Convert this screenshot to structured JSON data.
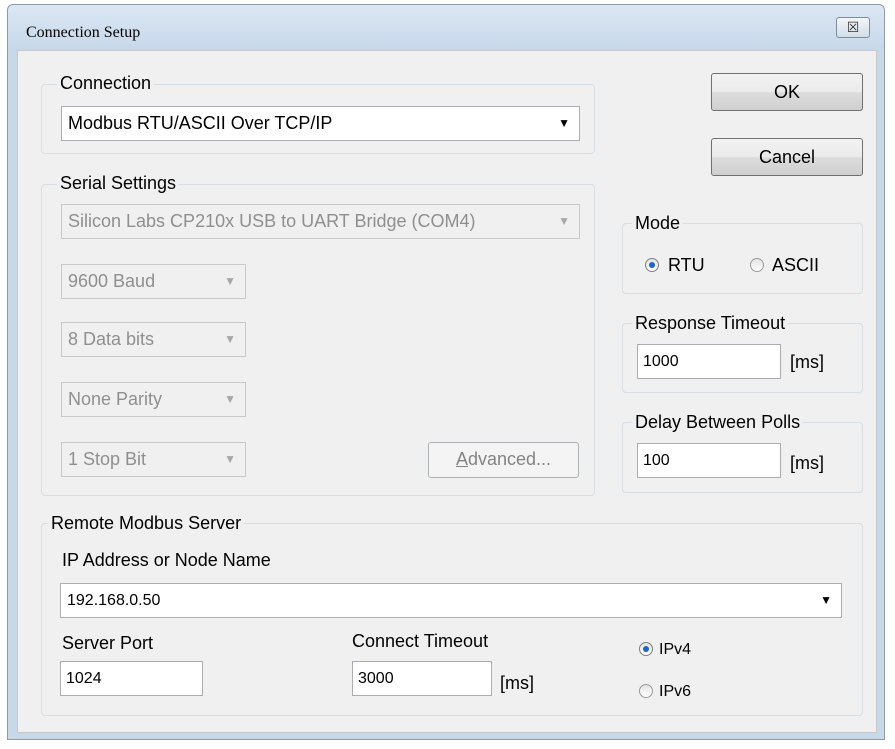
{
  "window": {
    "title": "Connection Setup",
    "close_glyph": "☒"
  },
  "connection": {
    "legend": "Connection",
    "selected": "Modbus RTU/ASCII Over TCP/IP"
  },
  "serial": {
    "legend": "Serial Settings",
    "port": "Silicon Labs CP210x USB to UART Bridge (COM4)",
    "baud": "9600 Baud",
    "data_bits": "8 Data bits",
    "parity": "None Parity",
    "stop_bits": "1 Stop Bit",
    "advanced_label": "Advanced...",
    "advanced_mnemonic": "A",
    "advanced_rest": "dvanced..."
  },
  "buttons": {
    "ok": "OK",
    "cancel": "Cancel"
  },
  "mode": {
    "legend": "Mode",
    "options": [
      "RTU",
      "ASCII"
    ],
    "selected": "RTU"
  },
  "response_timeout": {
    "legend": "Response Timeout",
    "value": "1000",
    "unit": "[ms]"
  },
  "delay_between_polls": {
    "legend": "Delay Between Polls",
    "value": "100",
    "unit": "[ms]"
  },
  "remote": {
    "legend": "Remote Modbus Server",
    "ip_label": "IP Address or Node Name",
    "ip_value": "192.168.0.50",
    "port_label": "Server Port",
    "port_value": "1024",
    "timeout_label": "Connect Timeout",
    "timeout_value": "3000",
    "timeout_unit": "[ms]",
    "ip_versions": [
      "IPv4",
      "IPv6"
    ],
    "ip_version_selected": "IPv4"
  }
}
